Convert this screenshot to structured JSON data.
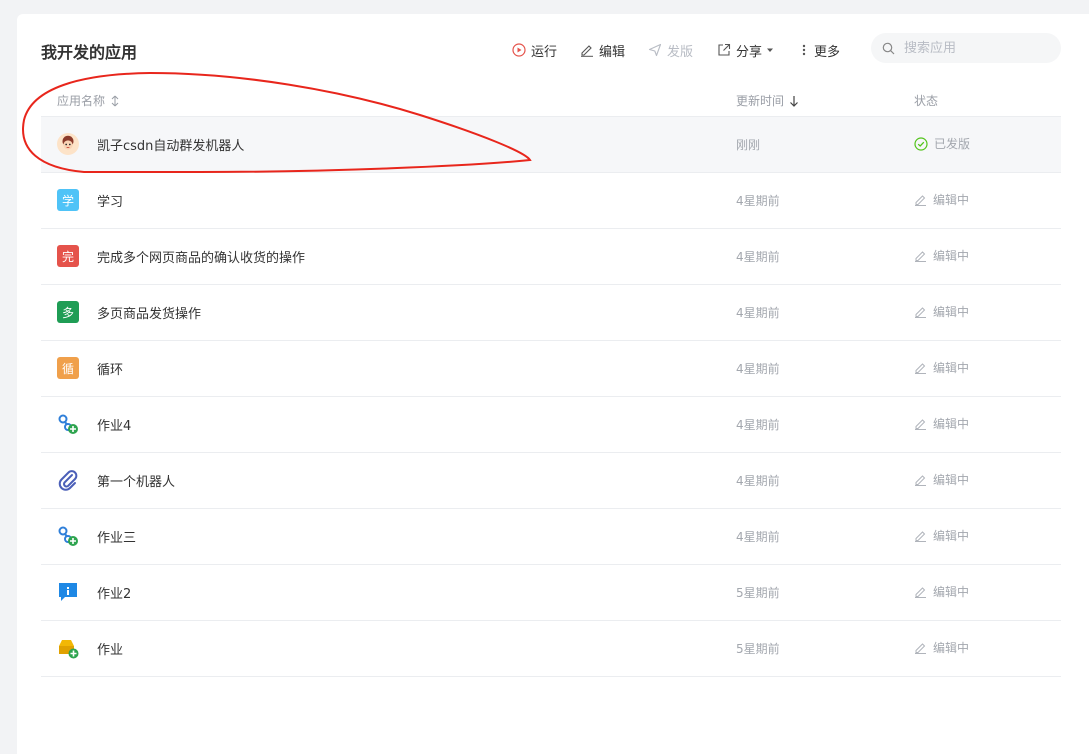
{
  "page_title": "我开发的应用",
  "toolbar": {
    "run": "运行",
    "edit": "编辑",
    "publish": "发版",
    "share": "分享",
    "more": "更多"
  },
  "search": {
    "placeholder": "搜索应用"
  },
  "table": {
    "col_name": "应用名称",
    "col_time": "更新时间",
    "col_status": "状态"
  },
  "apps": [
    {
      "name": "凯子csdn自动群发机器人",
      "time": "刚刚",
      "status": "已发版",
      "icon": "avatar-icon"
    },
    {
      "name": "学习",
      "time": "4星期前",
      "status": "编辑中",
      "icon": "letter-icon",
      "letter": "学",
      "color": "#4fc3f7"
    },
    {
      "name": "完成多个网页商品的确认收货的操作",
      "time": "4星期前",
      "status": "编辑中",
      "icon": "letter-icon",
      "letter": "完",
      "color": "#e5534b"
    },
    {
      "name": "多页商品发货操作",
      "time": "4星期前",
      "status": "编辑中",
      "icon": "letter-icon",
      "letter": "多",
      "color": "#1f9d55"
    },
    {
      "name": "循环",
      "time": "4星期前",
      "status": "编辑中",
      "icon": "letter-icon",
      "letter": "循",
      "color": "#f0a04b"
    },
    {
      "name": "作业4",
      "time": "4星期前",
      "status": "编辑中",
      "icon": "flow-plus-icon"
    },
    {
      "name": "第一个机器人",
      "time": "4星期前",
      "status": "编辑中",
      "icon": "paperclip-icon"
    },
    {
      "name": "作业三",
      "time": "4星期前",
      "status": "编辑中",
      "icon": "flow-plus-icon"
    },
    {
      "name": "作业2",
      "time": "5星期前",
      "status": "编辑中",
      "icon": "info-bubble-icon"
    },
    {
      "name": "作业",
      "time": "5星期前",
      "status": "编辑中",
      "icon": "folder-plus-icon"
    }
  ],
  "colors": {
    "annotation": "#e8261c",
    "published": "#52c41a"
  }
}
